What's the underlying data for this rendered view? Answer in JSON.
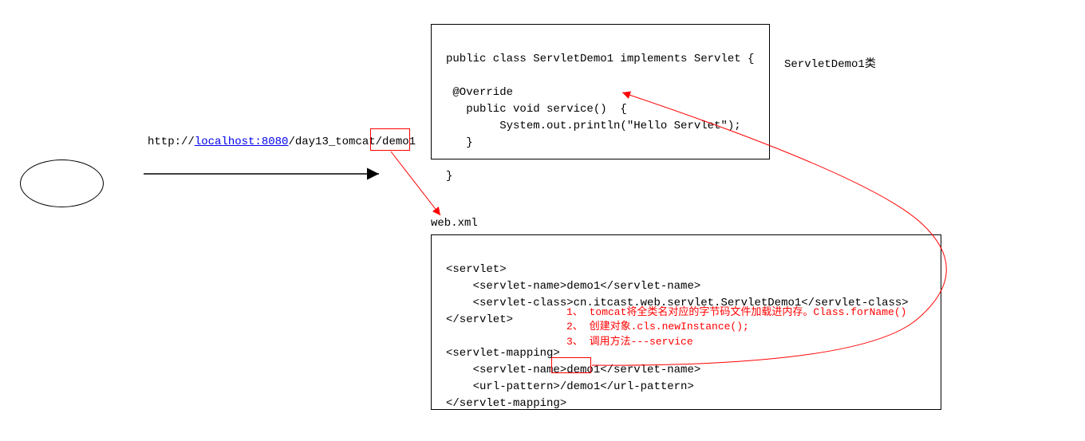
{
  "url": {
    "prefix": "http://",
    "host_port": "localhost:8080",
    "path1": "/day13_tomcat",
    "path2": "/demo1"
  },
  "code_box_top": {
    "line1": "public class ServletDemo1 implements Servlet {",
    "line2": "",
    "line3": " @Override",
    "line4": "   public void service()  {",
    "line5": "        System.out.println(\"Hello Servlet\");",
    "line6": "   }",
    "line7": "",
    "line8": "}"
  },
  "label_top_right": "ServletDemo1类",
  "label_webxml": "web.xml",
  "code_box_bottom": {
    "line1": "<servlet>",
    "line2": "    <servlet-name>demo1</servlet-name>",
    "line3": "    <servlet-class>cn.itcast.web.servlet.ServletDemo1</servlet-class>",
    "line4": "</servlet>",
    "line5": "",
    "line6": "<servlet-mapping>",
    "line7": "    <servlet-name>demo1</servlet-name>",
    "line8": "    <url-pattern>/demo1</url-pattern>",
    "line9": "</servlet-mapping>"
  },
  "red_annotation": {
    "line1": "1、 tomcat将全类名对应的字节码文件加载进内存。Class.forName()",
    "line2": "2、 创建对象.cls.newInstance();",
    "line3": "3、 调用方法---service"
  }
}
